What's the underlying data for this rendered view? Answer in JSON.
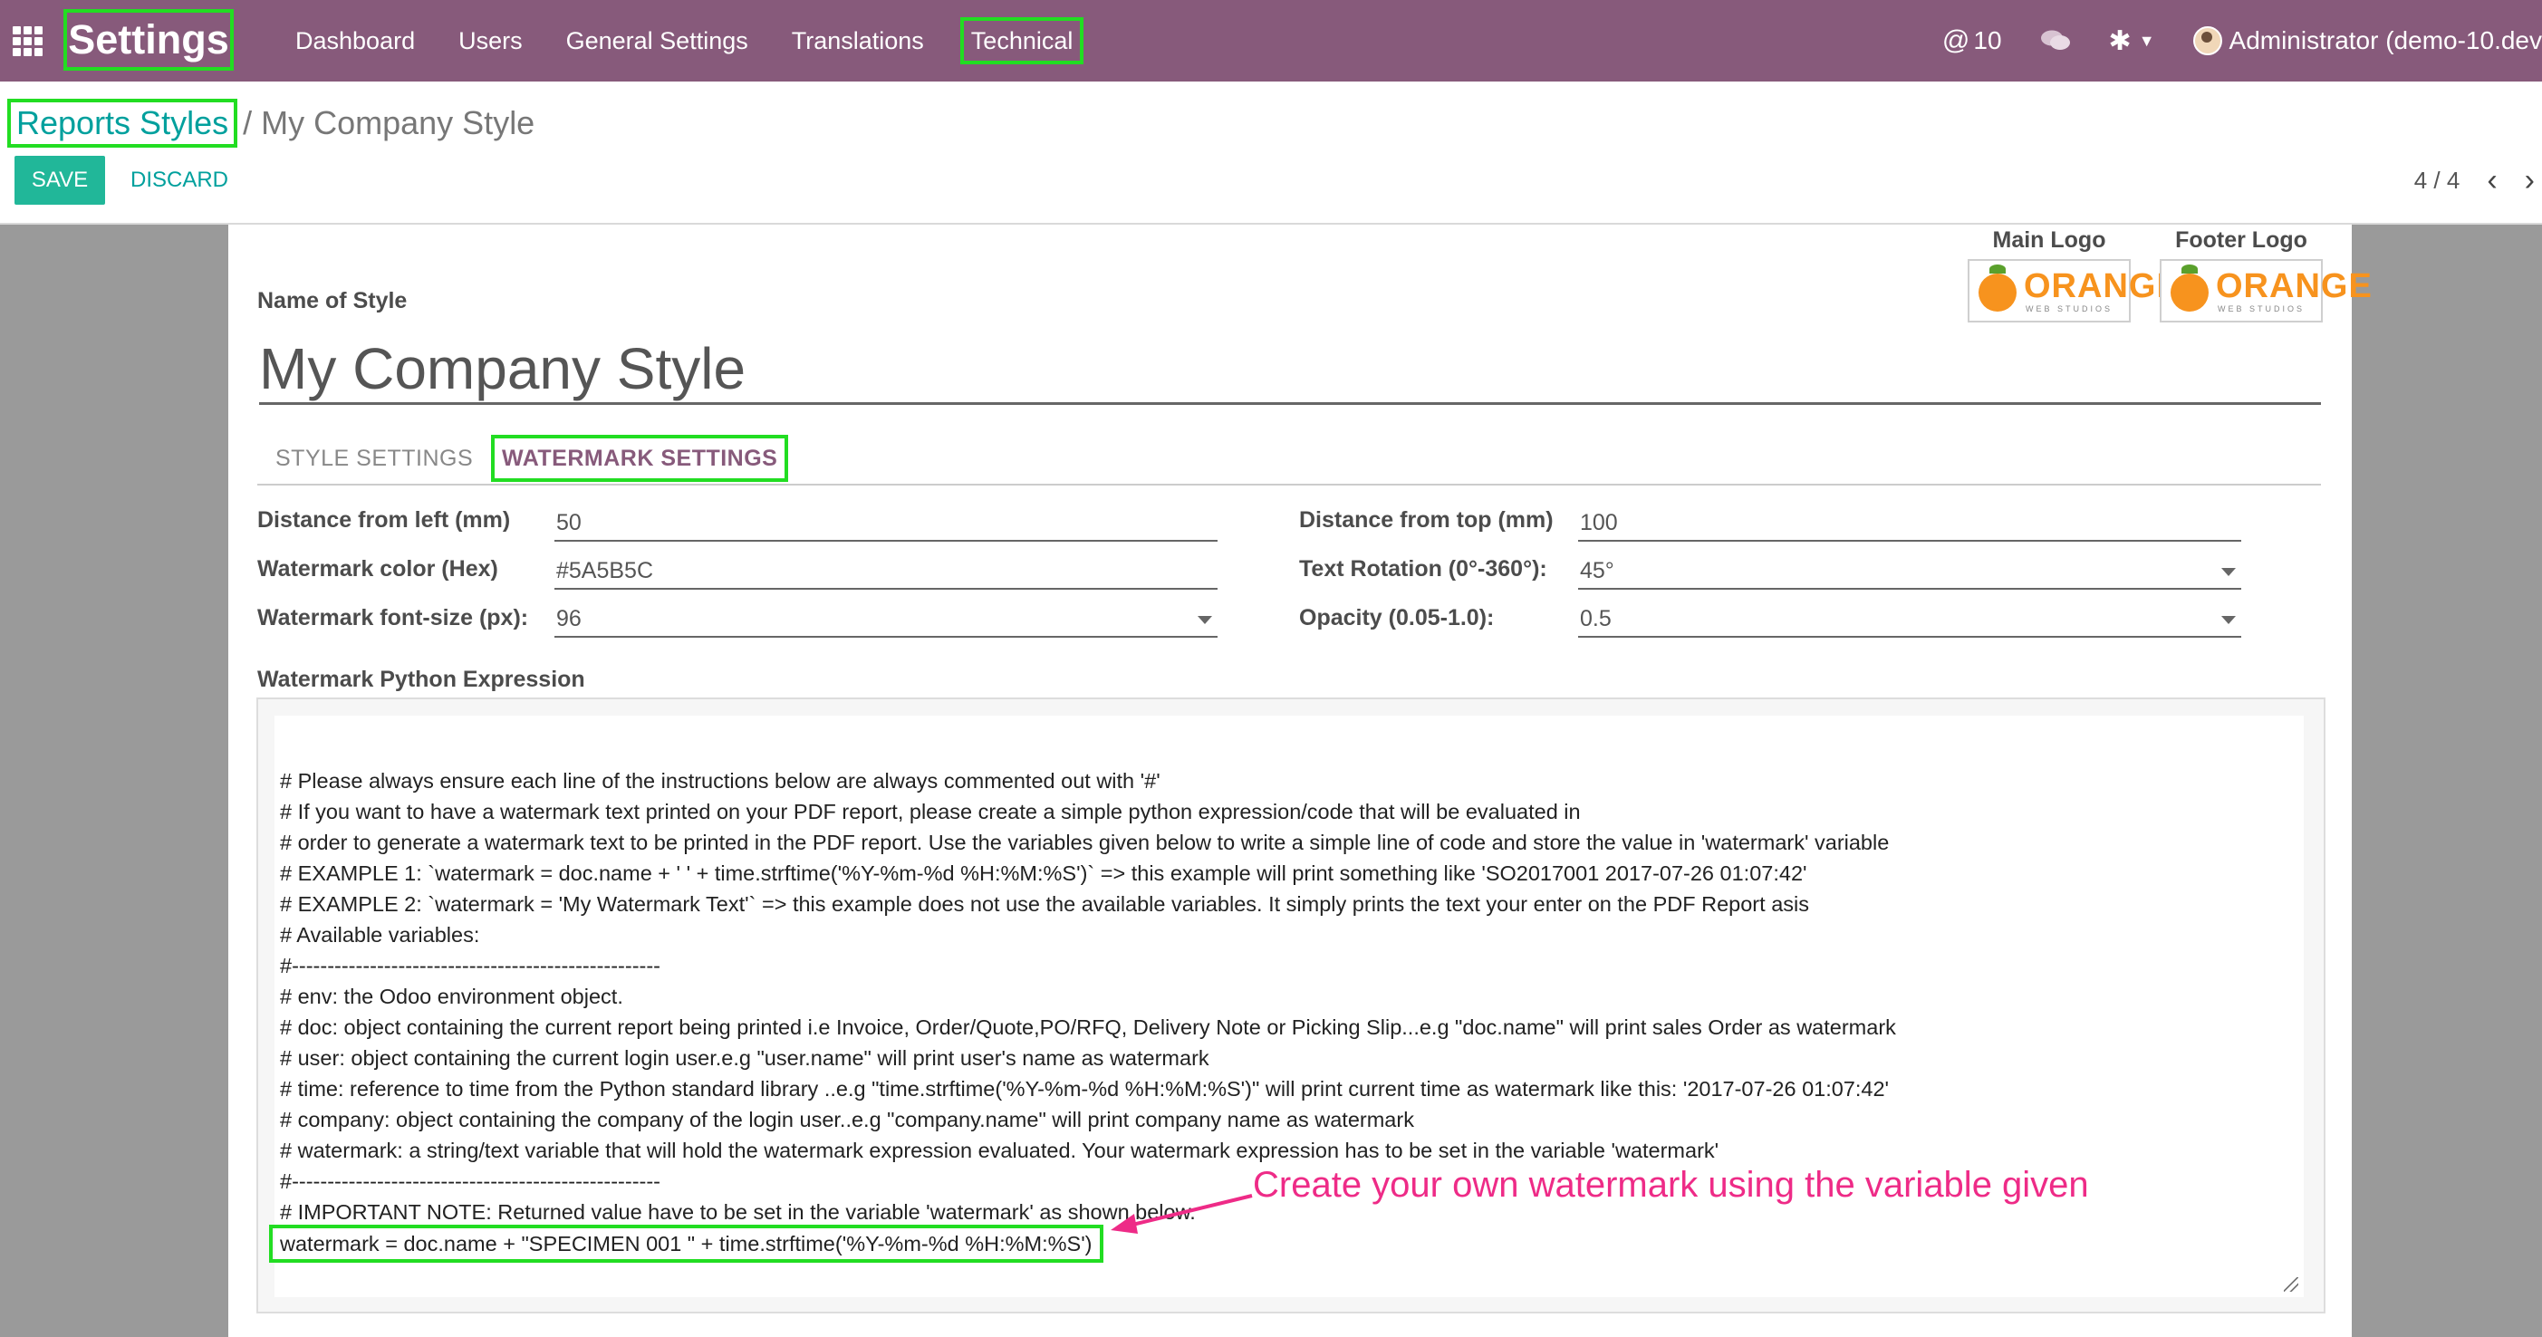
{
  "navbar": {
    "brand": "Settings",
    "menu": [
      "Dashboard",
      "Users",
      "General Settings",
      "Translations",
      "Technical"
    ],
    "mentions": "10",
    "user": "Administrator (demo-10.dev"
  },
  "breadcrumb": {
    "parent": "Reports Styles",
    "separator": "/",
    "current": "My Company Style"
  },
  "buttons": {
    "save": "SAVE",
    "discard": "DISCARD"
  },
  "pager": {
    "value": "4 / 4"
  },
  "logos": {
    "main_title": "Main Logo",
    "footer_title": "Footer Logo",
    "logo_text": "ORANGE",
    "logo_sub": "WEB STUDIOS"
  },
  "form": {
    "name_label": "Name of Style",
    "name_value": "My Company Style",
    "tabs": [
      "STYLE SETTINGS",
      "WATERMARK SETTINGS"
    ],
    "fields": {
      "left_label": "Distance from left (mm)",
      "left_value": "50",
      "color_label": "Watermark color (Hex)",
      "color_value": "#5A5B5C",
      "fontsize_label": "Watermark font-size (px):",
      "fontsize_value": "96",
      "top_label": "Distance from top (mm)",
      "top_value": "100",
      "rotation_label": "Text Rotation (0°-360°):",
      "rotation_value": "45°",
      "opacity_label": "Opacity (0.05-1.0):",
      "opacity_value": "0.5"
    },
    "expr_label": "Watermark Python Expression",
    "code_lines": [
      "# Please always ensure each line of the instructions below are always commented out with '#'",
      "# If you want to have a watermark text printed on your PDF report, please create a simple python expression/code  that will be evaluated in",
      "# order to generate a watermark text to be printed in the PDF report. Use the variables given below to write a simple line of code and store the value in 'watermark' variable",
      "# EXAMPLE 1: `watermark = doc.name + ' ' + time.strftime('%Y-%m-%d %H:%M:%S')` => this example will print something like 'SO2017001 2017-07-26 01:07:42'",
      "# EXAMPLE 2: `watermark = 'My Watermark Text'` => this example does not use the available variables. It simply prints the text your enter on the PDF Report asis",
      "# Available variables:",
      "#----------------------------------------------------",
      "# env: the Odoo environment object.",
      "# doc: object containing the current report being printed i.e Invoice, Order/Quote,PO/RFQ, Delivery Note or Picking Slip...e.g \"doc.name\" will print sales Order as watermark",
      "# user: object containing the current login user.e.g \"user.name\" will print user's name as watermark",
      "# time: reference to time from the Python standard library ..e.g \"time.strftime('%Y-%m-%d %H:%M:%S')\" will print current time as watermark like this: '2017-07-26 01:07:42'",
      "# company: object containing the company of the login user..e.g \"company.name\" will print company name as watermark",
      "# watermark: a string/text variable that will hold the watermark expression evaluated. Your watermark expression has to be set in the variable 'watermark'",
      "#----------------------------------------------------",
      "# IMPORTANT NOTE: Returned value have to be set in the variable 'watermark' as shown below.",
      "watermark = doc.name + \"SPECIMEN 001 \" +  time.strftime('%Y-%m-%d %H:%M:%S')"
    ]
  },
  "annotation": "Create your own watermark using the variable given",
  "colors": {
    "navbar": "#875a7b",
    "link": "#00a09d",
    "save": "#21b799",
    "highlight": "#22dd22",
    "annotation": "#ee2b87"
  }
}
